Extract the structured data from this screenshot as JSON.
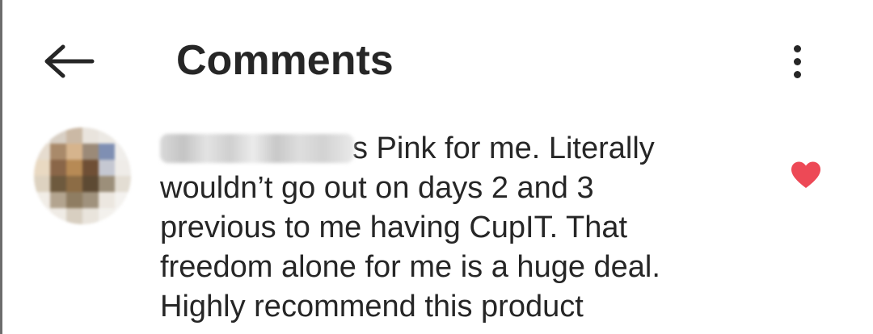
{
  "header": {
    "title": "Comments",
    "back_icon": "arrow-left-icon",
    "more_icon": "vertical-dots-icon"
  },
  "comment": {
    "avatar_colors": [
      "#f0ede8",
      "#d8cfc4",
      "#cbb9a5",
      "#e9e4dd",
      "#ece9e4",
      "#f3f1ee",
      "#e6dccf",
      "#a98a6a",
      "#d6b48d",
      "#9b8a78",
      "#7f8fb3",
      "#f0eeeb",
      "#e9d9c2",
      "#8a6648",
      "#b78a55",
      "#6f4f35",
      "#c5c8d2",
      "#efece8",
      "#ddd2c0",
      "#6e5a3e",
      "#8c6c45",
      "#5d4a33",
      "#9c8f7a",
      "#e3ddd3",
      "#f1ede7",
      "#b3a48f",
      "#8f7d62",
      "#a0927d",
      "#ece7e0",
      "#f4f2ef",
      "#f5f3f0",
      "#efebe5",
      "#d8cfc1",
      "#e9e4dc",
      "#f3f1ed",
      "#f6f4f2"
    ],
    "redacted_name": "",
    "lines": [
      "s Pink for me. Literally",
      "wouldn’t go out on days 2 and 3",
      "previous to me having CupIT. That",
      "freedom alone for me is a huge deal.",
      "Highly recommend this product"
    ],
    "liked": true,
    "like_icon": "heart-filled-icon",
    "like_color": "#ed4956"
  }
}
